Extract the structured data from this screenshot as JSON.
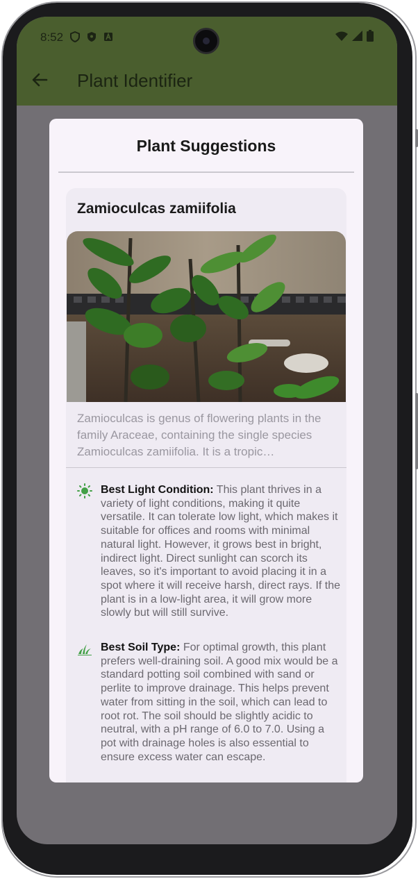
{
  "status_bar": {
    "time": "8:52",
    "icons": [
      "shield-icon",
      "shield-filled-icon",
      "app-a-icon"
    ],
    "right_icons": [
      "wifi-icon",
      "signal-icon",
      "battery-icon"
    ]
  },
  "app_bar": {
    "title": "Plant Identifier",
    "back_icon": "arrow-left-icon",
    "color": "#4a5e2e"
  },
  "dialog": {
    "title": "Plant Suggestions",
    "suggestion": {
      "name": "Zamioculcas zamiifolia",
      "description": "Zamioculcas is genus of flowering plants in the family Araceae, containing the single species Zamioculcas zamiifolia. It is a tropic…",
      "light": {
        "icon": "sun-icon",
        "label": "Best Light Condition:",
        "text": " This plant thrives in a variety of light conditions, making it quite versatile. It can tolerate low light, which makes it suitable for offices and rooms with minimal natural light. However, it grows best in bright, indirect light. Direct sunlight can scorch its leaves, so it's important to avoid placing it in a spot where it will receive harsh, direct rays. If the plant is in a low-light area, it will grow more slowly but will still survive."
      },
      "soil": {
        "icon": "grass-icon",
        "label": "Best Soil Type:",
        "text": " For optimal growth, this plant prefers well-draining soil. A good mix would be a standard potting soil combined with sand or perlite to improve drainage. This helps prevent water from sitting in the soil, which can lead to root rot. The soil should be slightly acidic to neutral, with a pH range of 6.0 to 7.0. Using a pot with drainage holes is also essential to ensure excess water can escape."
      }
    }
  },
  "colors": {
    "accent_green": "#43a047",
    "dim_overlay": "#726f74"
  }
}
